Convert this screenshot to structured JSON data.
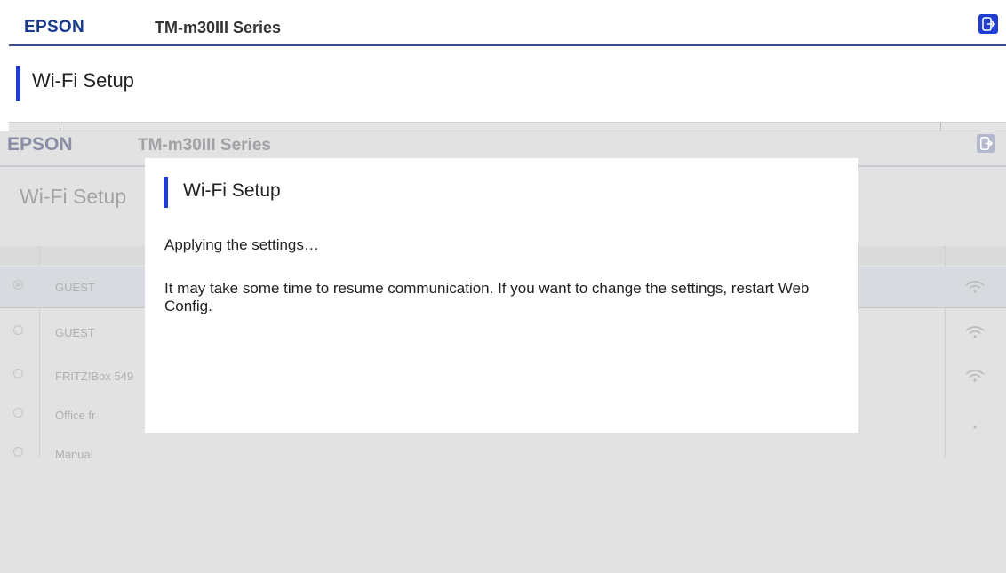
{
  "header": {
    "logo": "EPSON",
    "model": "TM-m30III Series",
    "logout_icon": "logout-icon"
  },
  "page": {
    "title": "Wi-Fi Setup"
  },
  "background": {
    "logo": "EPSON",
    "model": "TM-m30III Series",
    "title": "Wi-Fi Setup",
    "networks": [
      {
        "ssid": "GUEST",
        "selected": true,
        "signal": "wifi-icon"
      },
      {
        "ssid": "GUEST",
        "selected": false,
        "signal": "wifi-icon"
      },
      {
        "ssid": "FRITZ!Box 549",
        "selected": false,
        "signal": "wifi-icon"
      },
      {
        "ssid": "Office fr",
        "selected": false,
        "signal": "dot"
      },
      {
        "ssid": "Manual",
        "selected": false,
        "signal": ""
      }
    ]
  },
  "modal": {
    "title": "Wi-Fi Setup",
    "status": "Applying the settings…",
    "message": "It may take some time to resume communication. If you want to change the settings, restart Web Config."
  },
  "colors": {
    "accent": "#1f3ed1",
    "brand": "#1a3a8f",
    "overlay": "#e2e2e2"
  }
}
